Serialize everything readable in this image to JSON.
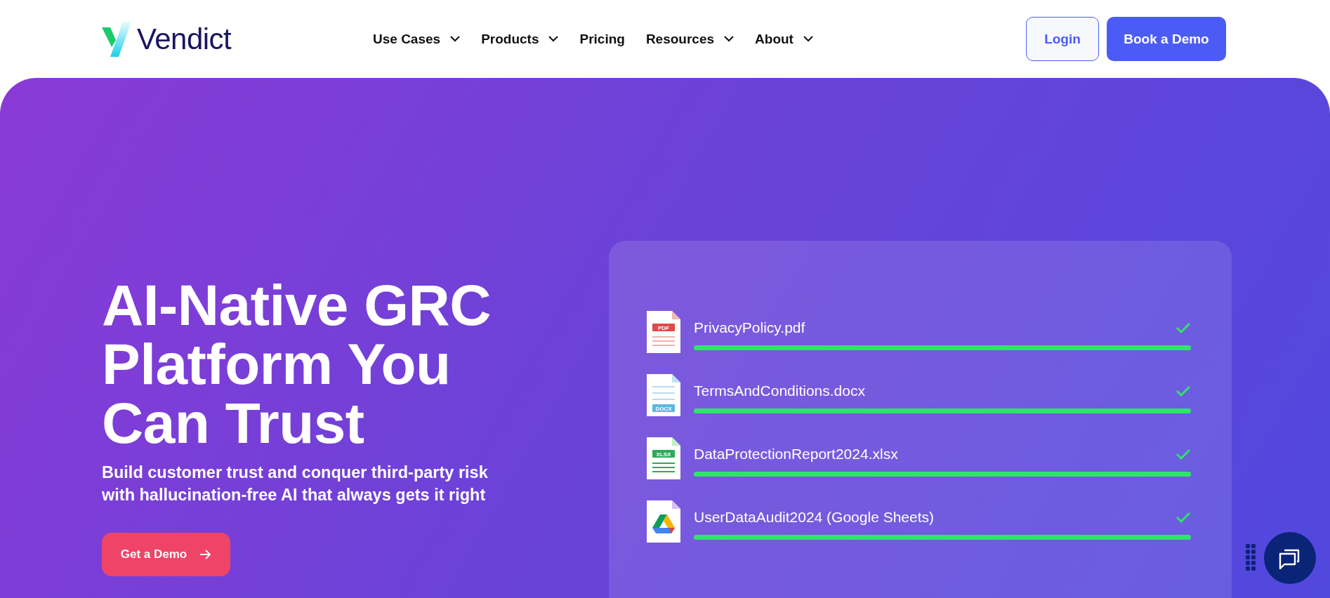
{
  "header": {
    "logo": "Vendict",
    "nav": [
      {
        "label": "Use Cases",
        "dropdown": true
      },
      {
        "label": "Products",
        "dropdown": true
      },
      {
        "label": "Pricing",
        "dropdown": false
      },
      {
        "label": "Resources",
        "dropdown": true
      },
      {
        "label": "About",
        "dropdown": true
      }
    ],
    "login": "Login",
    "cta": "Book a Demo"
  },
  "hero": {
    "title_lines": [
      "AI-Native GRC",
      "Platform You",
      "Can Trust"
    ],
    "subtitle_lines": [
      "Build customer trust and conquer third-party risk",
      "with hallucination-free AI that always gets it right"
    ],
    "button": "Get a Demo"
  },
  "files": [
    {
      "name": "PrivacyPolicy.pdf",
      "kind": "pdf",
      "badge": "PDF",
      "level": 1,
      "done": true
    },
    {
      "name": "TermsAndConditions.docx",
      "kind": "docx",
      "badge": "DOCX",
      "level": 1,
      "done": true
    },
    {
      "name": "DataProtectionReport2024.xlsx",
      "kind": "xlsx",
      "badge": "XLSX",
      "level": 1,
      "done": true
    },
    {
      "name": "UserDataAudit2024 (Google Sheets)",
      "kind": "gsheet",
      "level": 1,
      "done": true
    }
  ]
}
